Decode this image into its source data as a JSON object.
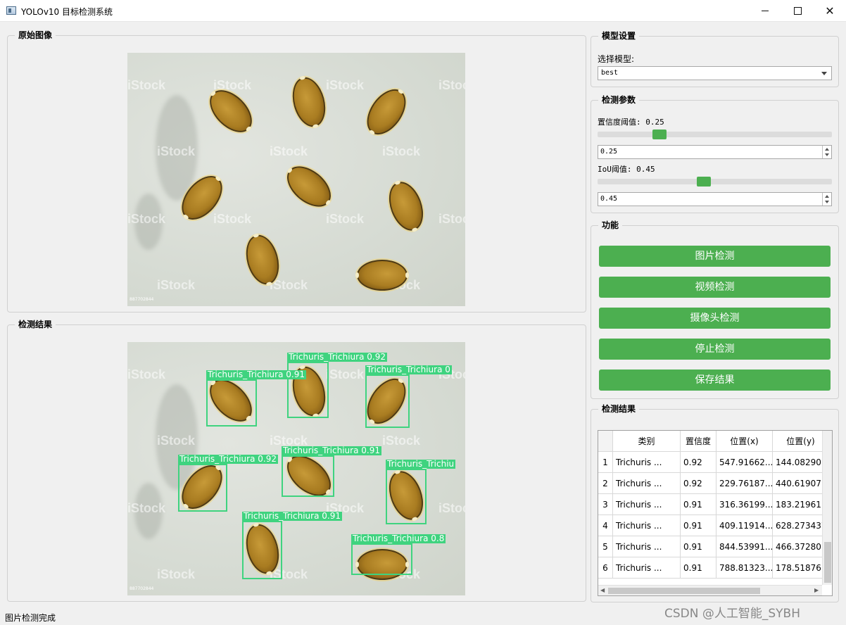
{
  "window": {
    "title": "YOLOv10 目标检测系统"
  },
  "panels": {
    "original_image": "原始图像",
    "detection_image": "检测结果",
    "model_settings": "模型设置",
    "detection_params": "检测参数",
    "functions": "功能",
    "results_table": "检测结果"
  },
  "model": {
    "select_label": "选择模型:",
    "selected": "best"
  },
  "params": {
    "confidence_label": "置信度阈值: 0.25",
    "confidence_value": "0.25",
    "confidence": 0.25,
    "iou_label": "IoU阈值: 0.45",
    "iou_value": "0.45",
    "iou": 0.45
  },
  "buttons": {
    "image_detect": "图片检测",
    "video_detect": "视频检测",
    "camera_detect": "摄像头检测",
    "stop_detect": "停止检测",
    "save_result": "保存结果"
  },
  "table": {
    "headers": [
      "类别",
      "置信度",
      "位置(x)",
      "位置(y)"
    ],
    "rows": [
      {
        "num": "1",
        "cls": "Trichuris ...",
        "conf": "0.92",
        "x": "547.91662...",
        "y": "144.08290..."
      },
      {
        "num": "2",
        "cls": "Trichuris ...",
        "conf": "0.92",
        "x": "229.76187...",
        "y": "440.61907..."
      },
      {
        "num": "3",
        "cls": "Trichuris ...",
        "conf": "0.91",
        "x": "316.36199...",
        "y": "183.21961..."
      },
      {
        "num": "4",
        "cls": "Trichuris ...",
        "conf": "0.91",
        "x": "409.11914...",
        "y": "628.273437"
      },
      {
        "num": "5",
        "cls": "Trichuris ...",
        "conf": "0.91",
        "x": "844.53991...",
        "y": "466.37280..."
      },
      {
        "num": "6",
        "cls": "Trichuris ...",
        "conf": "0.91",
        "x": "788.81323...",
        "y": "178.51876..."
      }
    ]
  },
  "detections": {
    "d1": "Trichuris_Trichiura  0.92",
    "d2": "Trichuris_Trichiura  0.91",
    "d3": "Trichuris_Trichiura  0",
    "d4": "Trichuris_Trichiura  0.91",
    "d5": "Trichuris_Trichiura  0.92",
    "d6": "Trichuris_Trichiu",
    "d7": "Trichuris_Trichiura  0.91",
    "d8": "Trichuris_Trichiura  0.8"
  },
  "watermark": "iStock",
  "stock_id": "887702844",
  "status": "图片检测完成",
  "csdn_watermark": "CSDN @人工智能_SYBH",
  "colors": {
    "accent_green": "#4caf50",
    "box_green": "#3fd37f"
  }
}
